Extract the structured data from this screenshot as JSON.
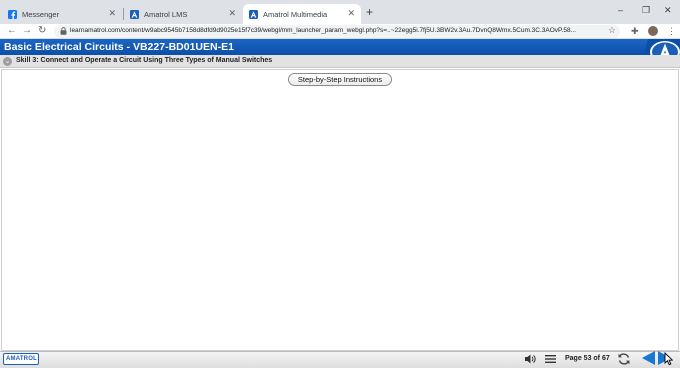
{
  "browser": {
    "tabs": [
      {
        "title": "Messenger",
        "icon": "messenger-icon",
        "active": false
      },
      {
        "title": "Amatrol LMS",
        "icon": "amatrol-icon",
        "active": false
      },
      {
        "title": "Amatrol Multimedia",
        "icon": "amatrol-icon",
        "active": true
      }
    ],
    "url": "learnamatrol.com/content/w9abc9545b7158d8dfd9d9025e15f7c39/webgl/mm_launcher_param_webgl.php?s=..~22egg5i.7fj5U.3BW2v.3Au.7DvnQ8Wmx.5Cum.3C.3AOvP.58..."
  },
  "app": {
    "title": "Basic Electrical Circuits - VB227-BD01UEN-E1",
    "skill_title": "Skill 3: Connect and Operate a Circuit Using Three Types of Manual Switches",
    "step_button": "Step-by-Step Instructions",
    "footer_logo": "AMATROL",
    "page_indicator": "Page 53 of 67",
    "brand_color": "#1565c0"
  }
}
